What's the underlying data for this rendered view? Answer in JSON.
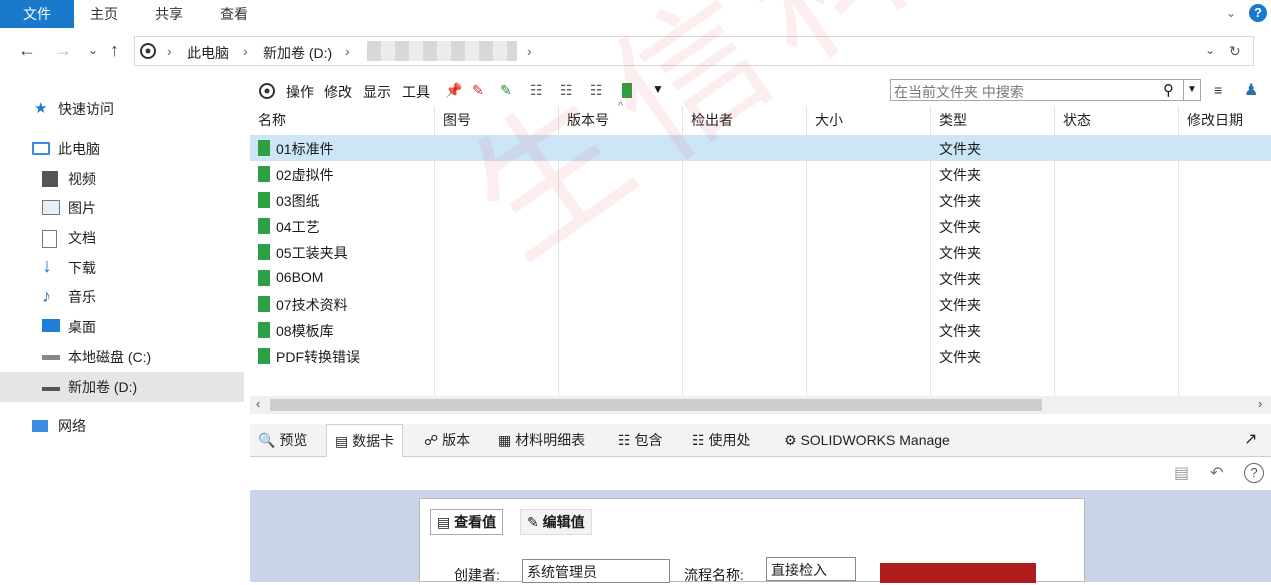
{
  "ribbon": {
    "tabs": [
      "文件",
      "主页",
      "共享",
      "查看"
    ]
  },
  "address": {
    "crumbs": [
      "此电脑",
      "新加卷 (D:)"
    ]
  },
  "nav": {
    "quick_access": "快速访问",
    "this_pc": "此电脑",
    "items": [
      "视频",
      "图片",
      "文档",
      "下载",
      "音乐",
      "桌面",
      "本地磁盘 (C:)",
      "新加卷 (D:)"
    ],
    "network": "网络"
  },
  "toolbar": {
    "actions": [
      "操作",
      "修改",
      "显示",
      "工具"
    ],
    "search_placeholder": "在当前文件夹 中搜索"
  },
  "grid": {
    "columns": [
      "名称",
      "图号",
      "版本号",
      "检出者",
      "大小",
      "类型",
      "状态",
      "修改日期"
    ],
    "rows": [
      {
        "name": "01标准件",
        "type": "文件夹"
      },
      {
        "name": "02虚拟件",
        "type": "文件夹"
      },
      {
        "name": "03图纸",
        "type": "文件夹"
      },
      {
        "name": "04工艺",
        "type": "文件夹"
      },
      {
        "name": "05工装夹具",
        "type": "文件夹"
      },
      {
        "name": "06BOM",
        "type": "文件夹"
      },
      {
        "name": "07技术资料",
        "type": "文件夹"
      },
      {
        "name": "08模板库",
        "type": "文件夹"
      },
      {
        "name": "PDF转换错误",
        "type": "文件夹"
      }
    ]
  },
  "bottom_tabs": [
    "预览",
    "数据卡",
    "版本",
    "材料明细表",
    "包含",
    "使用处",
    "SOLIDWORKS Manage"
  ],
  "card": {
    "tabs": [
      "查看值",
      "编辑值"
    ],
    "creator_label": "创建者:",
    "creator_value": "系统管理员",
    "workflow_label": "流程名称:",
    "workflow_value": "直接检入"
  },
  "watermark": "生信科技",
  "colors": {
    "accent": "#1979ca",
    "selection": "#cce5f7",
    "folder": "#2ea043"
  }
}
